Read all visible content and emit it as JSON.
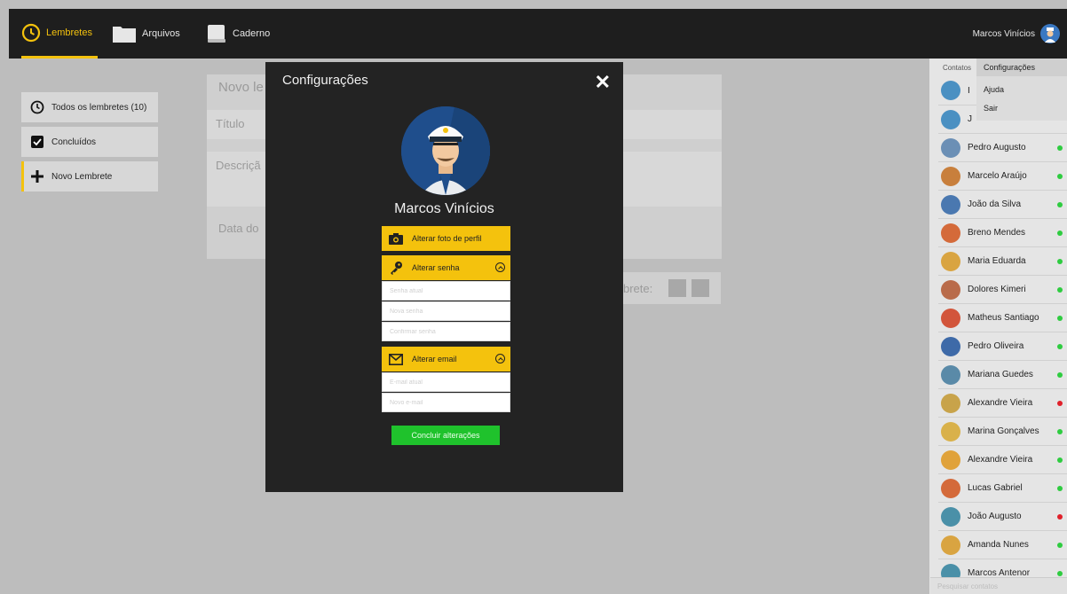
{
  "topbar": {
    "nav": [
      {
        "label": "Lembretes",
        "icon": "clock-icon",
        "active": true
      },
      {
        "label": "Arquivos",
        "icon": "folder-icon",
        "active": false
      },
      {
        "label": "Caderno",
        "icon": "notebook-icon",
        "active": false
      }
    ],
    "user_name": "Marcos Vinícios"
  },
  "sidebar": {
    "items": [
      {
        "label": "Todos os lembretes (10)",
        "icon": "clock-icon"
      },
      {
        "label": "Concluídos",
        "icon": "checkbox-icon"
      },
      {
        "label": "Novo Lembrete",
        "icon": "plus-icon"
      }
    ]
  },
  "form_bg": {
    "title": "Novo le",
    "titulo_placeholder": "Título",
    "descricao_placeholder": "Descriçã",
    "data_label": "Data do",
    "lembrete_label": "brete:"
  },
  "modal": {
    "title": "Configurações",
    "user_name": "Marcos Vinícios",
    "change_photo": "Alterar foto de perfil",
    "change_password": "Alterar senha",
    "current_password_placeholder": "Senha atual",
    "new_password_placeholder": "Nova senha",
    "confirm_password_placeholder": "Confirmar senha",
    "change_email": "Alterar email",
    "current_email_placeholder": "E-mail atual",
    "new_email_placeholder": "Novo e-mail",
    "submit": "Concluir alterações"
  },
  "dropdown": {
    "items": [
      "Configurações",
      "Ajuda",
      "Sair"
    ]
  },
  "contacts": {
    "header": "Contatos",
    "hidden_initials": [
      "I",
      "J"
    ],
    "list": [
      {
        "name": "Pedro Augusto",
        "status": "online"
      },
      {
        "name": "Marcelo Araújo",
        "status": "online"
      },
      {
        "name": "João da Silva",
        "status": "online"
      },
      {
        "name": "Breno Mendes",
        "status": "online"
      },
      {
        "name": "Maria Eduarda",
        "status": "online"
      },
      {
        "name": "Dolores Kimeri",
        "status": "online"
      },
      {
        "name": "Matheus Santiago",
        "status": "online"
      },
      {
        "name": "Pedro Oliveira",
        "status": "online"
      },
      {
        "name": "Mariana Guedes",
        "status": "online"
      },
      {
        "name": "Alexandre Vieira",
        "status": "offline"
      },
      {
        "name": "Marina Gonçalves",
        "status": "online"
      },
      {
        "name": "Alexandre Vieira",
        "status": "online"
      },
      {
        "name": "Lucas Gabriel",
        "status": "online"
      },
      {
        "name": "João Augusto",
        "status": "offline"
      },
      {
        "name": "Amanda Nunes",
        "status": "online"
      },
      {
        "name": "Marcos Antenor",
        "status": "online"
      }
    ],
    "search_placeholder": "Pesquisar contatos"
  },
  "colors": {
    "accent": "#f4c20d",
    "topbar": "#1e1e1e",
    "modal": "#232323",
    "success": "#1fc22c",
    "online": "#2ecc40",
    "offline": "#e0202a"
  }
}
